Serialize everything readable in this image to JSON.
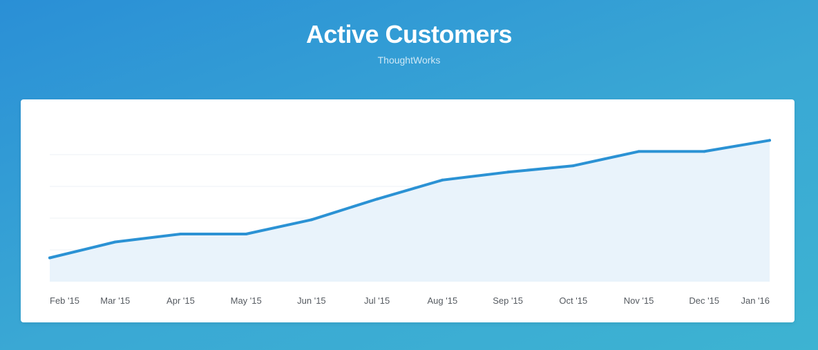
{
  "header": {
    "title": "Active Customers",
    "subtitle": "ThoughtWorks"
  },
  "colors": {
    "background_start": "#2a8fd6",
    "background_end": "#3db3d2",
    "line": "#2b92d4",
    "area_fill": "#e9f3fb",
    "gridline": "#edf1f4"
  },
  "chart_data": {
    "type": "area",
    "title": "Active Customers",
    "subtitle": "ThoughtWorks",
    "xlabel": "",
    "ylabel": "",
    "categories": [
      "Feb '15",
      "Mar '15",
      "Apr '15",
      "May '15",
      "Jun '15",
      "Jul '15",
      "Aug '15",
      "Sep '15",
      "Oct '15",
      "Nov '15",
      "Dec '15",
      "Jan '16"
    ],
    "series": [
      {
        "values": [
          7.5,
          12.5,
          15,
          15,
          19.5,
          26,
          32,
          34.5,
          36.5,
          41,
          41,
          44.5
        ]
      }
    ],
    "ylim": [
      0,
      50
    ],
    "grid": true,
    "legend": "none"
  }
}
